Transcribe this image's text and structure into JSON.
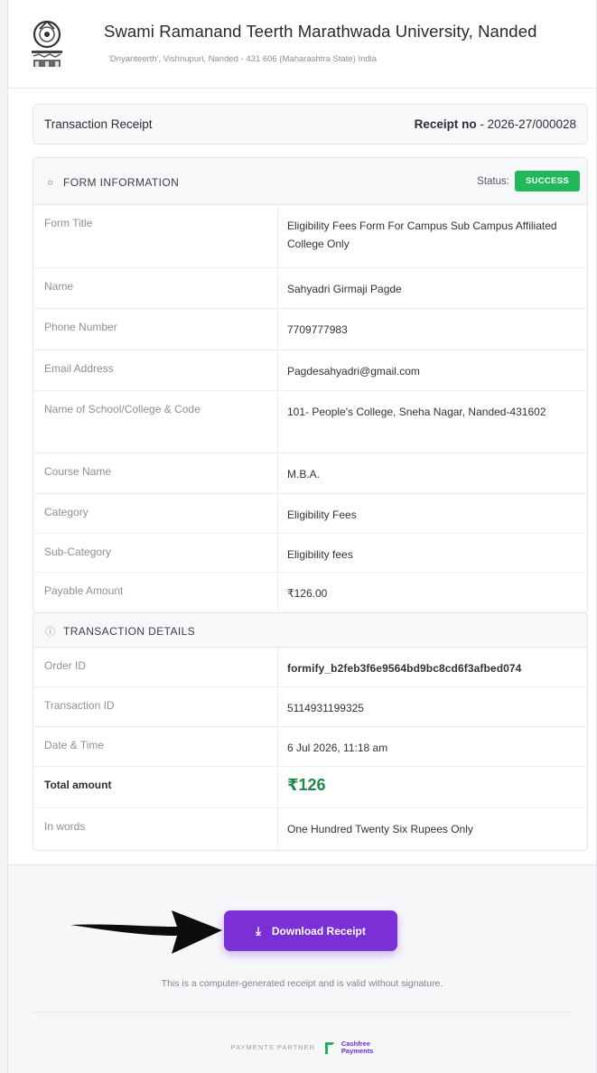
{
  "header": {
    "university_name": "Swami Ramanand Teerth Marathwada University, Nanded",
    "address": "'Dnyanteerth', Vishnupuri, Nanded - 431 606 (Maharashtra State) India"
  },
  "receipt": {
    "title": "Transaction Receipt",
    "number_label": "Receipt no",
    "number_value": "- 2026-27/000028"
  },
  "form_info": {
    "title": "FORM INFORMATION",
    "status_label": "Status:",
    "status": "SUCCESS",
    "status_color": "#20b85a",
    "rows": [
      {
        "label": "Form Title",
        "value": "Eligibility Fees Form For Campus Sub Campus Affiliated College Only"
      },
      {
        "label": "Name",
        "value": "Sahyadri Girmaji Pagde"
      },
      {
        "label": "Phone Number",
        "value": "7709777983"
      },
      {
        "label": "Email Address",
        "value": "Pagdesahyadri@gmail.com"
      },
      {
        "label": "Name of School/College & Code",
        "value": "101- People's College, Sneha Nagar, Nanded-431602"
      },
      {
        "label": "Course Name",
        "value": "M.B.A."
      },
      {
        "label": "Category",
        "value": "Eligibility Fees"
      },
      {
        "label": "Sub-Category",
        "value": "Eligibility fees"
      },
      {
        "label": "Payable Amount",
        "value": "₹126.00"
      }
    ]
  },
  "transaction": {
    "title": "TRANSACTION DETAILS",
    "rows": [
      {
        "label": "Order ID",
        "value": "formify_b2feb3f6e9564bd9bc8cd6f3afbed074"
      },
      {
        "label": "Transaction ID",
        "value": "5114931199325"
      },
      {
        "label": "Date & Time",
        "value": "6 Jul 2026, 11:18 am"
      },
      {
        "label": "Total amount",
        "value": "₹126"
      },
      {
        "label": "In words",
        "value": "One Hundred Twenty Six Rupees Only"
      }
    ]
  },
  "footer": {
    "download_label": "Download Receipt",
    "note": "This is a computer-generated receipt and is valid without signature.",
    "partner_label": "PAYMENTS PARTNER",
    "partner_name_line1": "Cashfree",
    "partner_name_line2": "Payments"
  },
  "colors": {
    "accent": "#7b2fd6",
    "success": "#20b85a",
    "total": "#1e8a49"
  },
  "icons": [
    "university-logo-icon",
    "user-icon",
    "info-icon",
    "download-icon",
    "arrow-icon",
    "cashfree-logo-icon"
  ]
}
